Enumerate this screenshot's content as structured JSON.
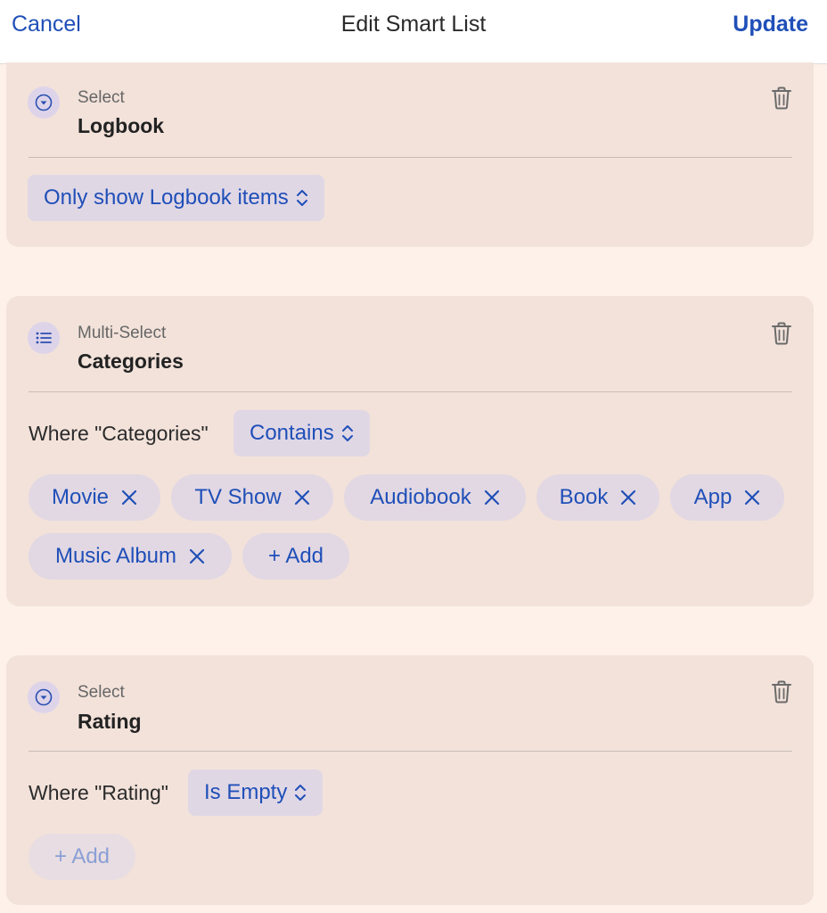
{
  "header": {
    "cancel_label": "Cancel",
    "title": "Edit Smart List",
    "update_label": "Update"
  },
  "filters": [
    {
      "type_label": "Select",
      "field": "Logbook",
      "icon": "chevron-circle-icon",
      "option": "Only show Logbook items"
    },
    {
      "type_label": "Multi-Select",
      "field": "Categories",
      "icon": "list-icon",
      "where_text": "Where \"Categories\"",
      "operator": "Contains",
      "values": [
        "Movie",
        "TV Show",
        "Audiobook",
        "Book",
        "App",
        "Music Album"
      ],
      "add_label": "+ Add"
    },
    {
      "type_label": "Select",
      "field": "Rating",
      "icon": "chevron-circle-icon",
      "where_text": "Where \"Rating\"",
      "operator": "Is Empty",
      "add_label": "+ Add"
    }
  ],
  "colors": {
    "accent": "#1f4fb8",
    "card_bg": "#f2e2da",
    "page_bg": "#fdf1e9",
    "pill_bg": "#e2d8e3"
  }
}
